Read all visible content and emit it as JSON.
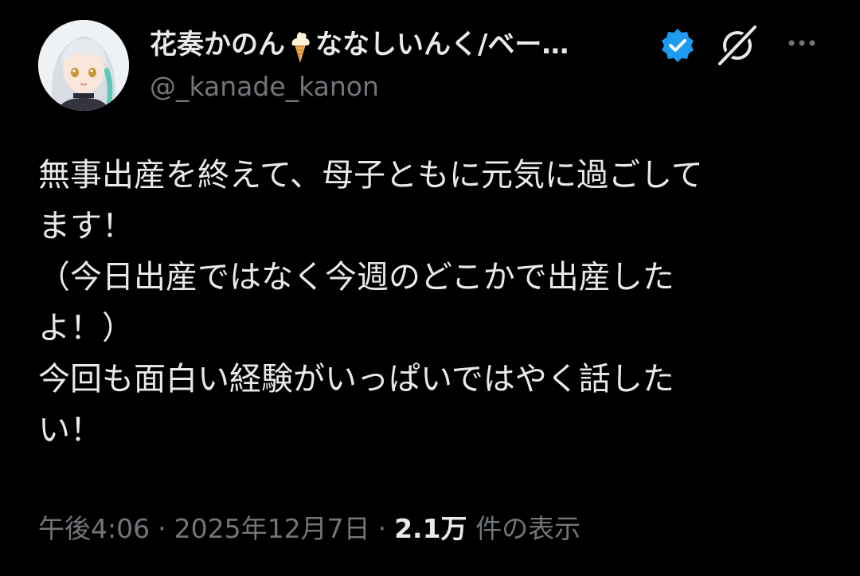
{
  "author": {
    "display_name": "花奏かのん",
    "name_emoji": "soft-ice-cream-icon",
    "display_name_rest": "ななしいんく/ベー…",
    "handle": "@_kanade_kanon",
    "verified_icon": "verified-badge-icon"
  },
  "actions": {
    "grok_icon": "grok-icon",
    "more_icon": "more-options-icon"
  },
  "post": {
    "text": "無事出産を終えて、母子ともに元気に過ごして\nます！\n（今日出産ではなく今週のどこかで出産した\nよ！）\n今回も面白い経験がいっぱいではやく話した\nい！"
  },
  "meta": {
    "time": "午後4:06",
    "separator": "·",
    "date": "2025年12月7日",
    "views_count": "2.1万",
    "views_label": "件の表示"
  },
  "colors": {
    "background": "#000000",
    "text_primary": "#e7e9ea",
    "text_secondary": "#71767b",
    "verified_blue": "#1d9bf0"
  }
}
